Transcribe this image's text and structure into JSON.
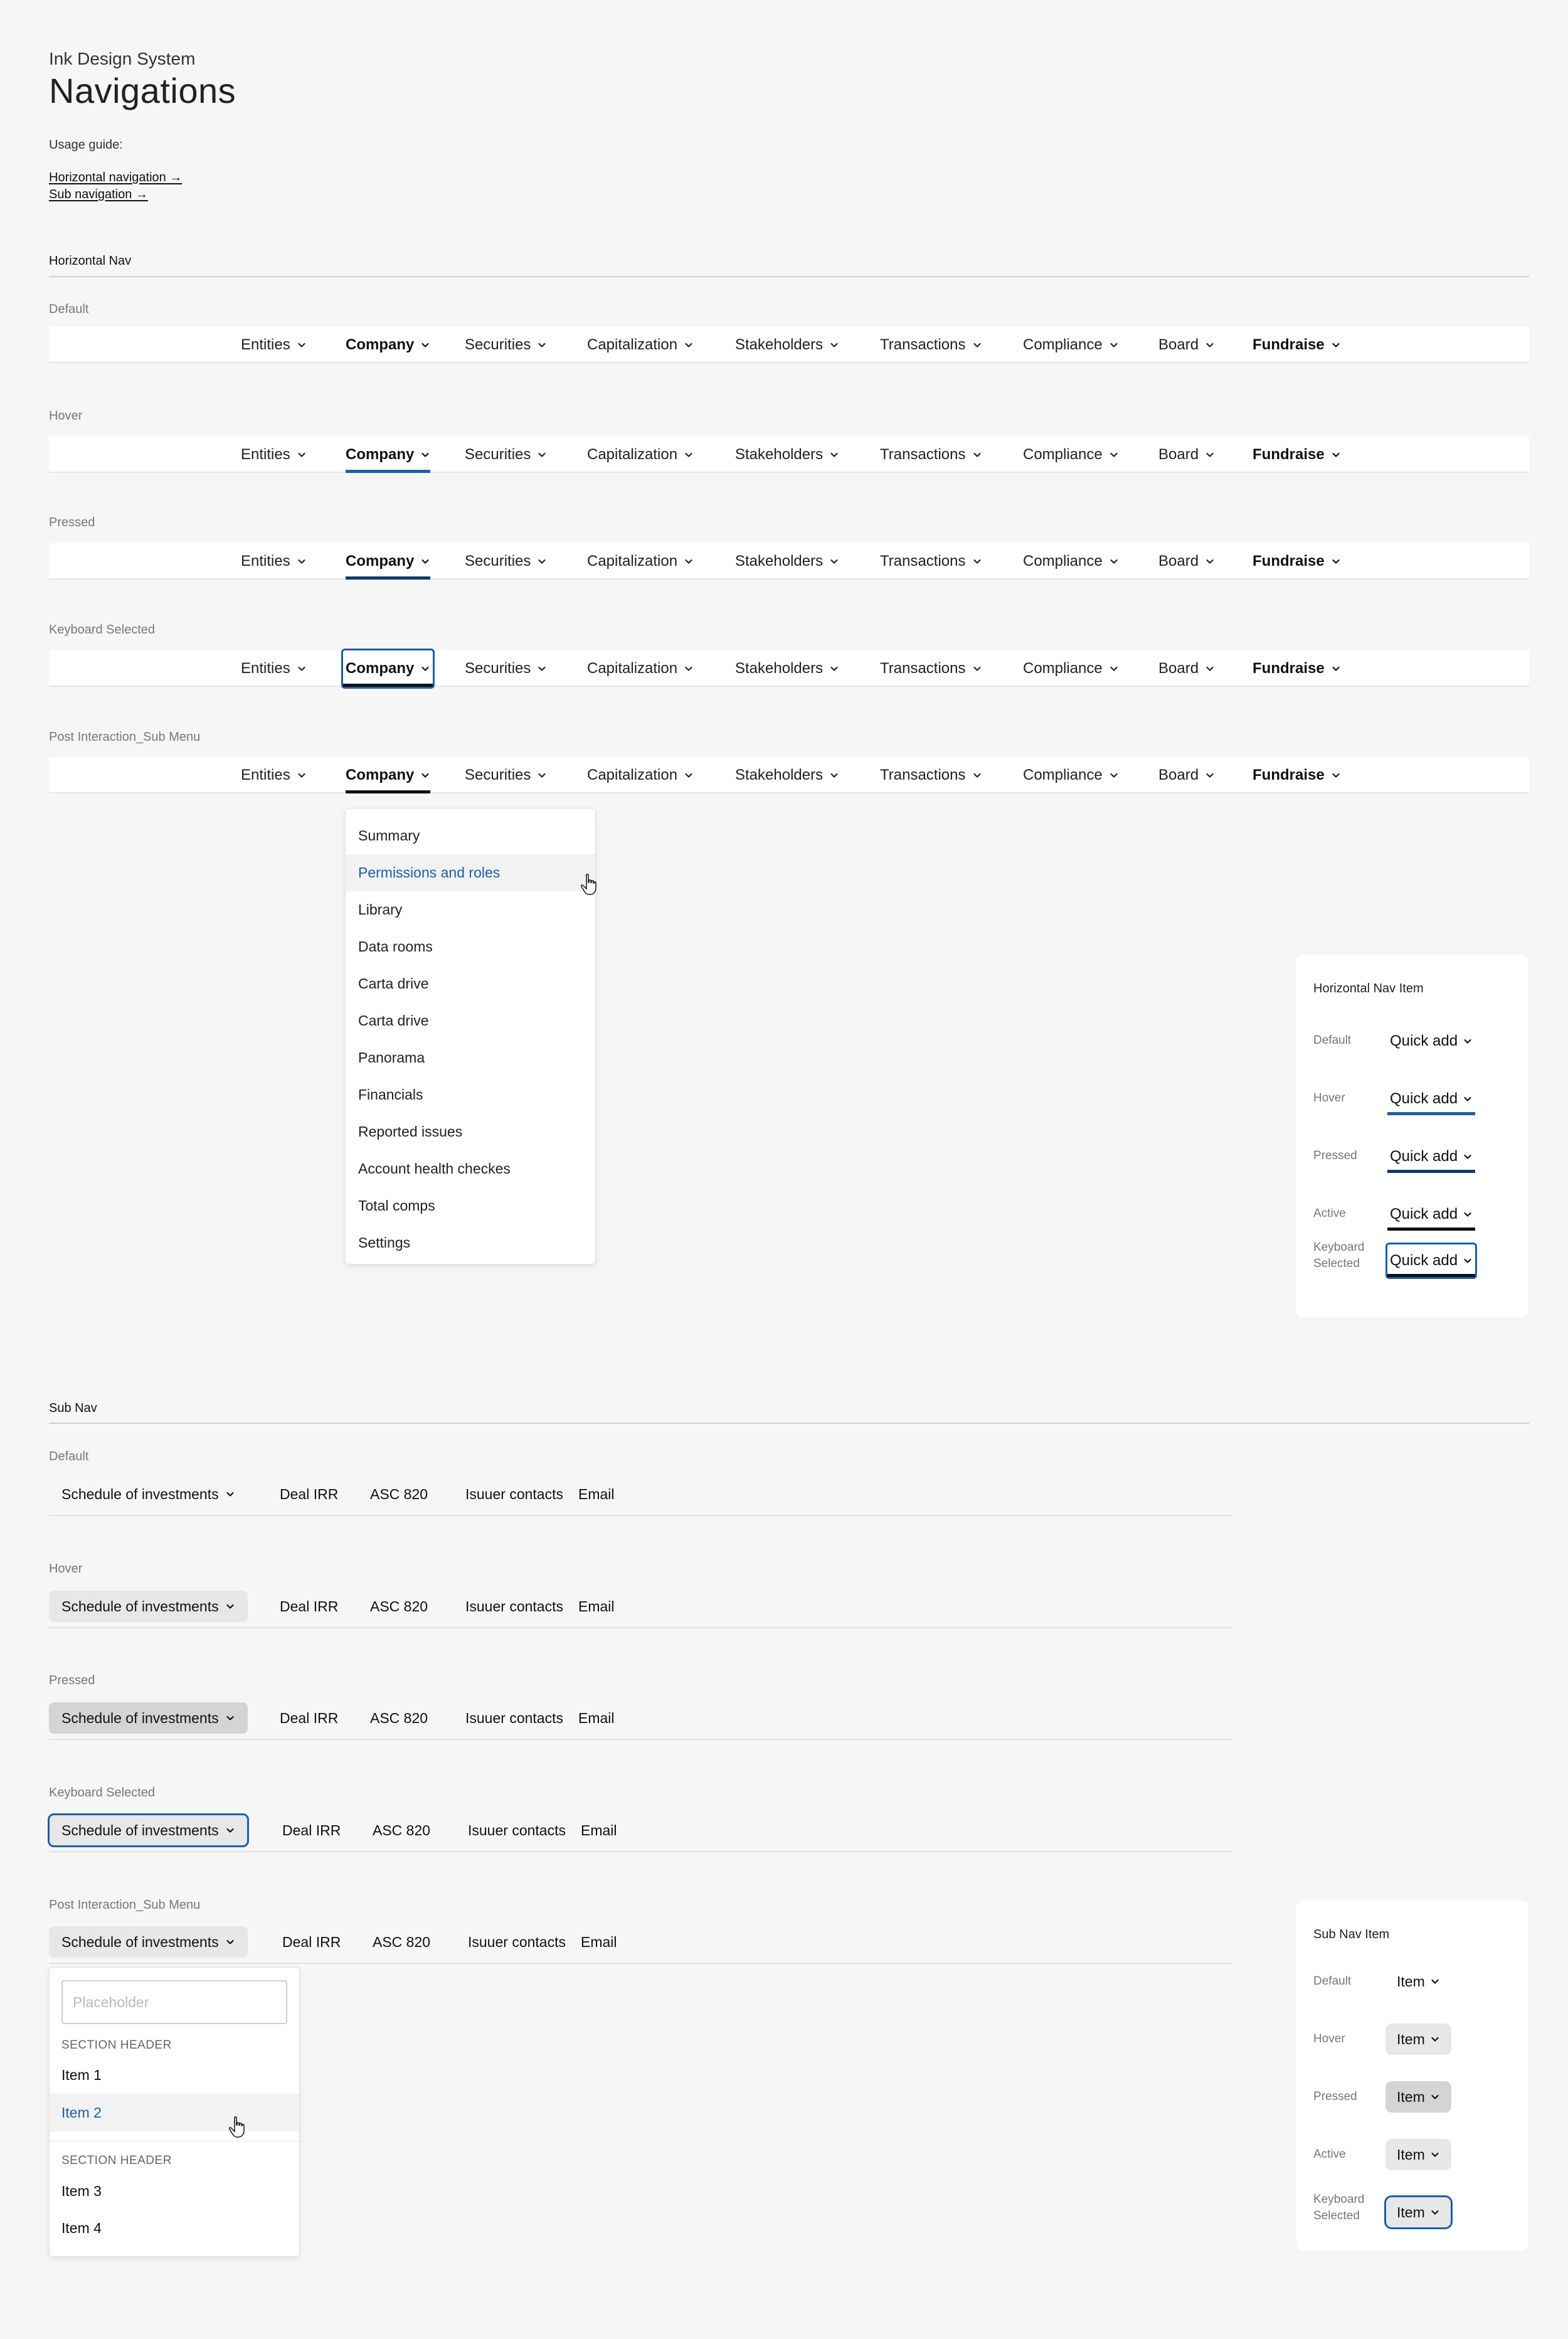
{
  "header": {
    "eyebrow": "Ink Design System",
    "title": "Navigations",
    "usage_label": "Usage guide:",
    "links": [
      "Horizontal navigation →",
      "Sub navigation →"
    ]
  },
  "horizontal_nav": {
    "section_title": "Horizontal Nav",
    "states": [
      "Default",
      "Hover",
      "Pressed",
      "Keyboard Selected",
      "Post Interaction_Sub Menu"
    ],
    "items": [
      "Entities",
      "Company",
      "Securities",
      "Capitalization",
      "Stakeholders",
      "Transactions",
      "Compliance",
      "Board",
      "Fundraise"
    ],
    "submenu_items": [
      "Summary",
      "Permissions and roles",
      "Library",
      "Data rooms",
      "Carta drive",
      "Carta drive",
      "Panorama",
      "Financials",
      "Reported issues",
      "Account health checkes",
      "Total comps",
      "Settings"
    ],
    "highlighted_submenu_item": "Permissions and roles"
  },
  "hnav_item_card": {
    "title": "Horizontal Nav Item",
    "states": [
      "Default",
      "Hover",
      "Pressed",
      "Active",
      "Keyboard Selected"
    ],
    "item_label": "Quick add"
  },
  "sub_nav": {
    "section_title": "Sub Nav",
    "states": [
      "Default",
      "Hover",
      "Pressed",
      "Keyboard Selected",
      "Post Interaction_Sub Menu"
    ],
    "items": [
      "Schedule of investments",
      "Deal IRR",
      "ASC 820",
      "Isuuer contacts",
      "Email"
    ],
    "submenu": {
      "placeholder": "Placeholder",
      "section_header_1": "SECTION HEADER",
      "section_header_2": "SECTION HEADER",
      "items": [
        "Item 1",
        "Item 2",
        "Item 3",
        "Item 4"
      ],
      "highlighted_item": "Item 2"
    }
  },
  "subnav_item_card": {
    "title": "Sub Nav Item",
    "states": [
      "Default",
      "Hover",
      "Pressed",
      "Active",
      "Keyboard Selected"
    ],
    "item_label": "Item"
  },
  "colors": {
    "accent_blue": "#1b5fa7",
    "pressed_blue": "#0d3a6b",
    "active_black": "#111111",
    "background": "#f6f6f6"
  }
}
